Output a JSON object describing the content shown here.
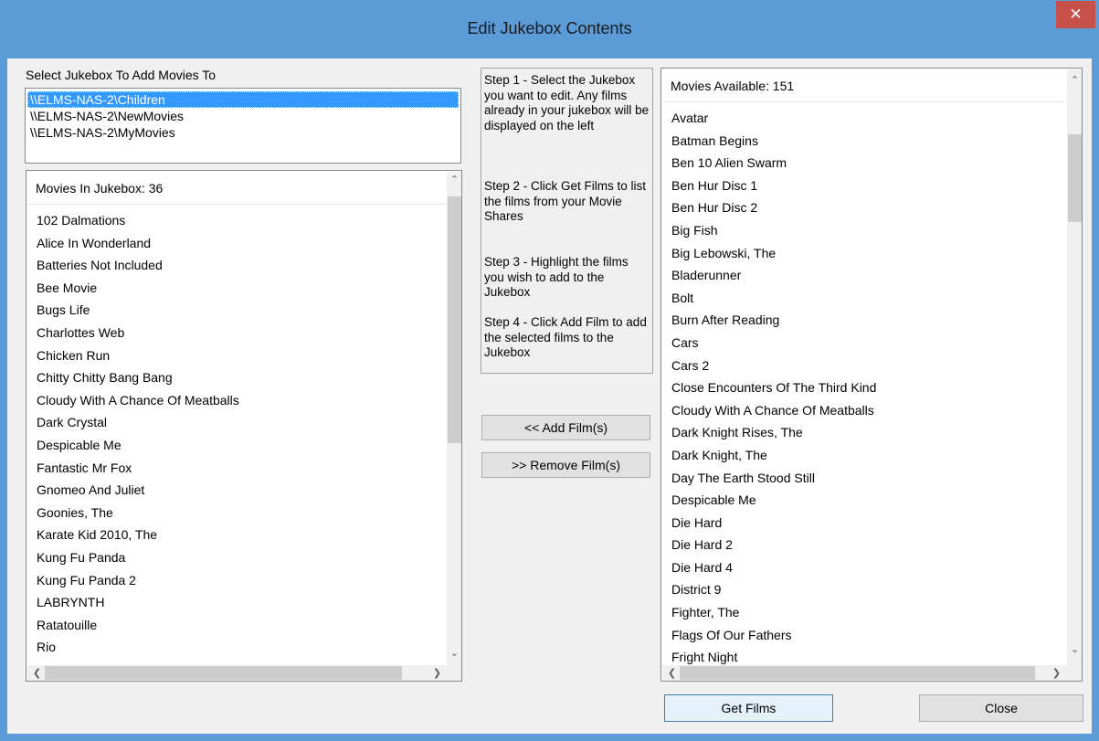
{
  "window": {
    "title": "Edit Jukebox Contents",
    "close_glyph": "✕"
  },
  "jukebox_select": {
    "label": "Select Jukebox To Add Movies To",
    "items": [
      "\\\\ELMS-NAS-2\\Children",
      "\\\\ELMS-NAS-2\\NewMovies",
      "\\\\ELMS-NAS-2\\MyMovies"
    ],
    "selected_index": 0
  },
  "jukebox_movies": {
    "header": "Movies In Jukebox: 36",
    "items": [
      "102 Dalmations",
      "Alice In Wonderland",
      "Batteries Not Included",
      "Bee Movie",
      "Bugs Life",
      "Charlottes Web",
      "Chicken Run",
      "Chitty Chitty Bang Bang",
      "Cloudy With A Chance Of Meatballs",
      "Dark Crystal",
      "Despicable Me",
      "Fantastic Mr Fox",
      "Gnomeo And Juliet",
      "Goonies, The",
      "Karate Kid 2010, The",
      "Kung Fu Panda",
      "Kung Fu Panda 2",
      "LABRYNTH",
      "Ratatouille",
      "Rio"
    ]
  },
  "instructions": {
    "step1": "Step 1 - Select the Jukebox you want to edit. Any films already in your jukebox will be displayed on the left",
    "step2": "Step 2 - Click Get Films to list the films from your Movie Shares",
    "step3": "Step 3 - Highlight the films you wish to add to the Jukebox",
    "step4": "Step 4 - Click Add Film to add the selected films to the Jukebox"
  },
  "buttons": {
    "add": "<< Add Film(s)",
    "remove": ">> Remove Film(s)",
    "get_films": "Get Films",
    "close": "Close"
  },
  "available_movies": {
    "header": "Movies Available: 151",
    "items": [
      "Avatar",
      "Batman Begins",
      "Ben 10 Alien Swarm",
      "Ben Hur Disc 1",
      "Ben Hur Disc 2",
      "Big Fish",
      "Big Lebowski, The",
      "Bladerunner",
      "Bolt",
      "Burn After Reading",
      "Cars",
      "Cars 2",
      "Close Encounters Of The Third Kind",
      "Cloudy With A Chance Of Meatballs",
      "Dark Knight Rises, The",
      "Dark Knight, The",
      "Day The Earth Stood Still",
      "Despicable Me",
      "Die Hard",
      "Die Hard 2",
      "Die Hard 4",
      "District 9",
      "Fighter, The",
      "Flags Of Our Fathers",
      "Fright Night"
    ]
  },
  "scroll_glyphs": {
    "up": "⌃",
    "down": "⌄",
    "left": "❮",
    "right": "❯"
  },
  "colors": {
    "frame": "#5b9bd8",
    "close": "#c7504a",
    "selection": "#3399ff"
  }
}
